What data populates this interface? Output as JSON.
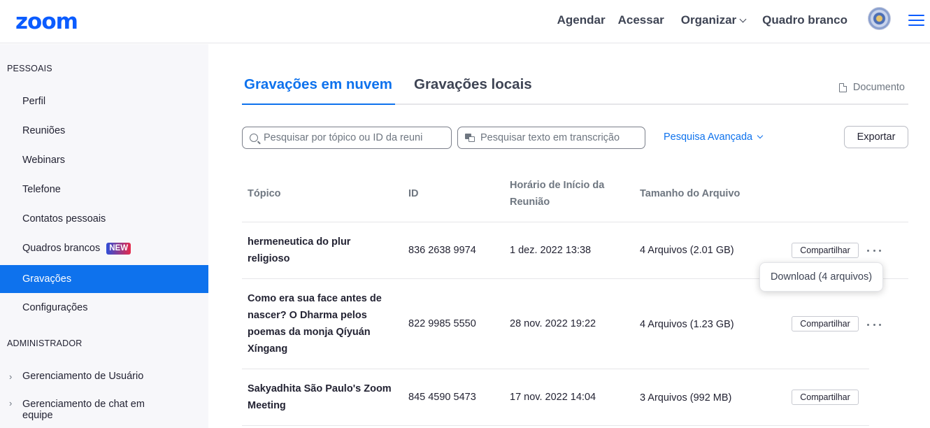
{
  "header": {
    "logo": "zoom",
    "nav": [
      "Agendar",
      "Acessar",
      "Organizar",
      "Quadro branco"
    ]
  },
  "sidebar": {
    "section_personal": "PESSOAIS",
    "personal_items": [
      {
        "label": "Perfil"
      },
      {
        "label": "Reuniões"
      },
      {
        "label": "Webinars"
      },
      {
        "label": "Telefone"
      },
      {
        "label": "Contatos pessoais"
      },
      {
        "label": "Quadros brancos",
        "badge": "NEW"
      },
      {
        "label": "Gravações",
        "active": true
      },
      {
        "label": "Configurações"
      }
    ],
    "section_admin": "ADMINISTRADOR",
    "admin_items": [
      {
        "label": "Gerenciamento de Usuário"
      },
      {
        "label": "Gerenciamento de chat em equipe"
      }
    ]
  },
  "tabs": {
    "cloud": "Gravações em nuvem",
    "local": "Gravações locais",
    "doc_link": "Documento"
  },
  "search": {
    "topic_placeholder": "Pesquisar por tópico ou ID da reuni",
    "transcript_placeholder": "Pesquisar texto em transcrição",
    "advanced": "Pesquisa Avançada",
    "export": "Exportar"
  },
  "table": {
    "headers": [
      "Tópico",
      "ID",
      "Horário de Início da Reunião",
      "Tamanho do Arquivo"
    ],
    "rows": [
      {
        "topic": "hermeneutica do plur religioso",
        "id": "836 2638 9974",
        "start": "1 dez. 2022 13:38",
        "size": "4 Arquivos (2.01 GB)",
        "action": "Compartilhar"
      },
      {
        "topic": "Como era sua face antes de nascer? O Dharma pelos poemas da monja Qíyuán Xíngang",
        "id": "822 9985 5550",
        "start": "28 nov. 2022 19:22",
        "size": "4 Arquivos (1.23 GB)",
        "action": "Compartilhar"
      },
      {
        "topic": "Sakyadhita São Paulo's Zoom Meeting",
        "id": "845 4590 5473",
        "start": "17 nov. 2022 14:04",
        "size": "3 Arquivos (992 MB)",
        "action": "Compartilhar"
      }
    ]
  },
  "dropdown": {
    "download": "Download (4 arquivos)"
  },
  "colors": {
    "brand": "#0b5cff",
    "active": "#0e72ed",
    "sidebar_bg": "#f7f7fa"
  }
}
